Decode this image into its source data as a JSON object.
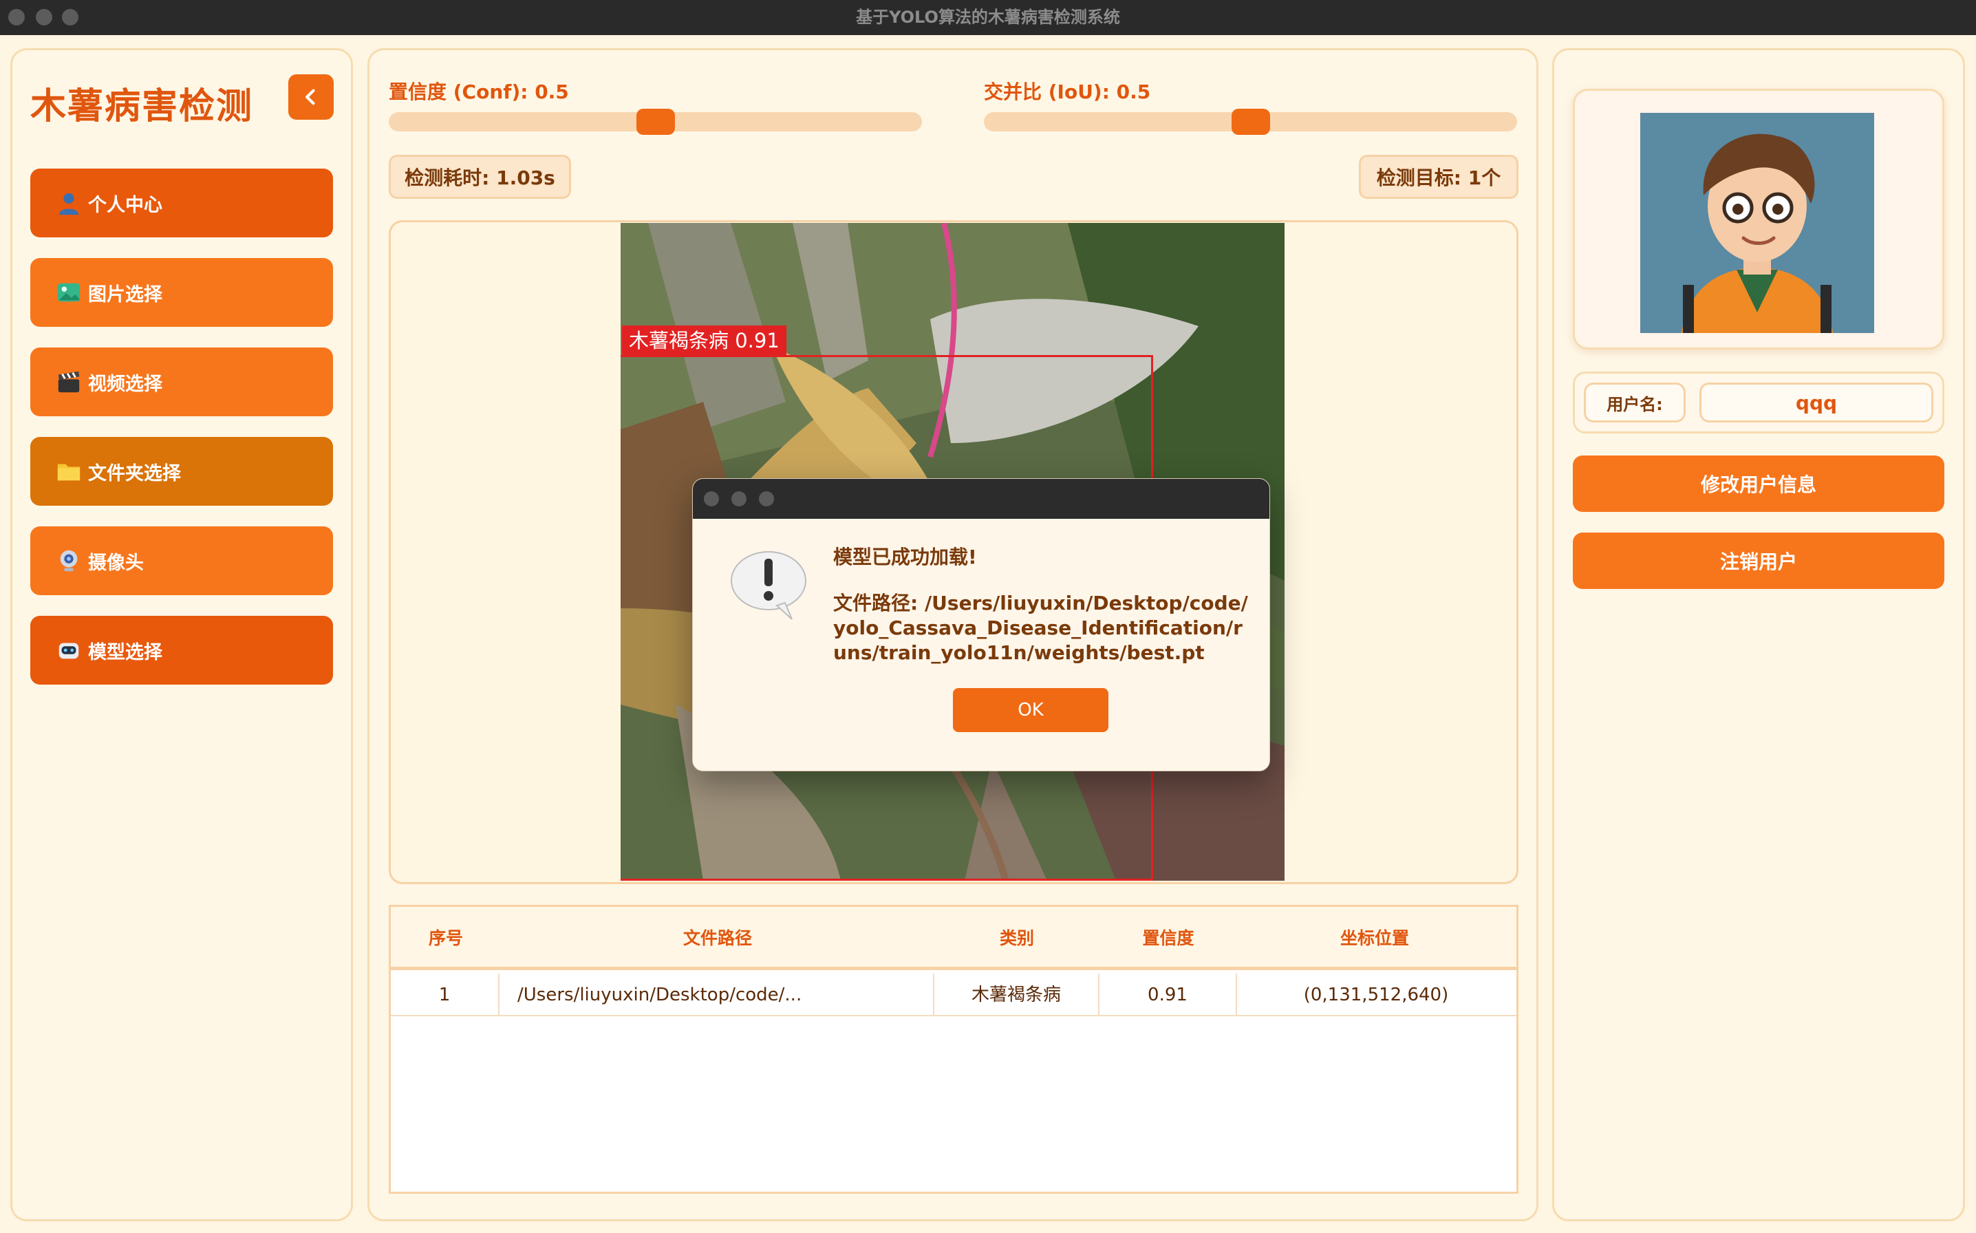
{
  "window": {
    "title": "基于YOLO算法的木薯病害检测系统"
  },
  "sidebar": {
    "title": "木薯病害检测",
    "items": [
      {
        "label": "个人中心",
        "icon": "user-icon",
        "color": "#e8590c"
      },
      {
        "label": "图片选择",
        "icon": "image-icon",
        "color": "#f7761c"
      },
      {
        "label": "视频选择",
        "icon": "clapperboard-icon",
        "color": "#f7761c"
      },
      {
        "label": "文件夹选择",
        "icon": "folder-icon",
        "color": "#da7308"
      },
      {
        "label": "摄像头",
        "icon": "camera-icon",
        "color": "#f7761c"
      },
      {
        "label": "模型选择",
        "icon": "robot-icon",
        "color": "#e8590c"
      }
    ]
  },
  "controls": {
    "conf_label": "置信度 (Conf): 0.5",
    "conf_value": 0.5,
    "iou_label": "交并比 (IoU): 0.5",
    "iou_value": 0.5,
    "time_label": "检测耗时: 1.03s",
    "target_label": "检测目标: 1个"
  },
  "detection": {
    "label": "木薯褐条病 0.91"
  },
  "dialog": {
    "heading": "模型已成功加载!",
    "path": "文件路径: /Users/liuyuxin/Desktop/code/yolo_Cassava_Disease_Identification/runs/train_yolo11n/weights/best.pt",
    "ok_label": "OK"
  },
  "table": {
    "headers": [
      "序号",
      "文件路径",
      "类别",
      "置信度",
      "坐标位置"
    ],
    "rows": [
      [
        "1",
        "/Users/liuyuxin/Desktop/code/...",
        "木薯褐条病",
        "0.91",
        "(0,131,512,640)"
      ]
    ]
  },
  "user": {
    "name_label": "用户名:",
    "name_value": "qqq",
    "edit_button": "修改用户信息",
    "logout_button": "注销用户"
  },
  "colors": {
    "accent": "#f06a14",
    "title_text": "#e0560e",
    "panel_bg": "#fff7e6",
    "border": "#f6dcb0"
  }
}
